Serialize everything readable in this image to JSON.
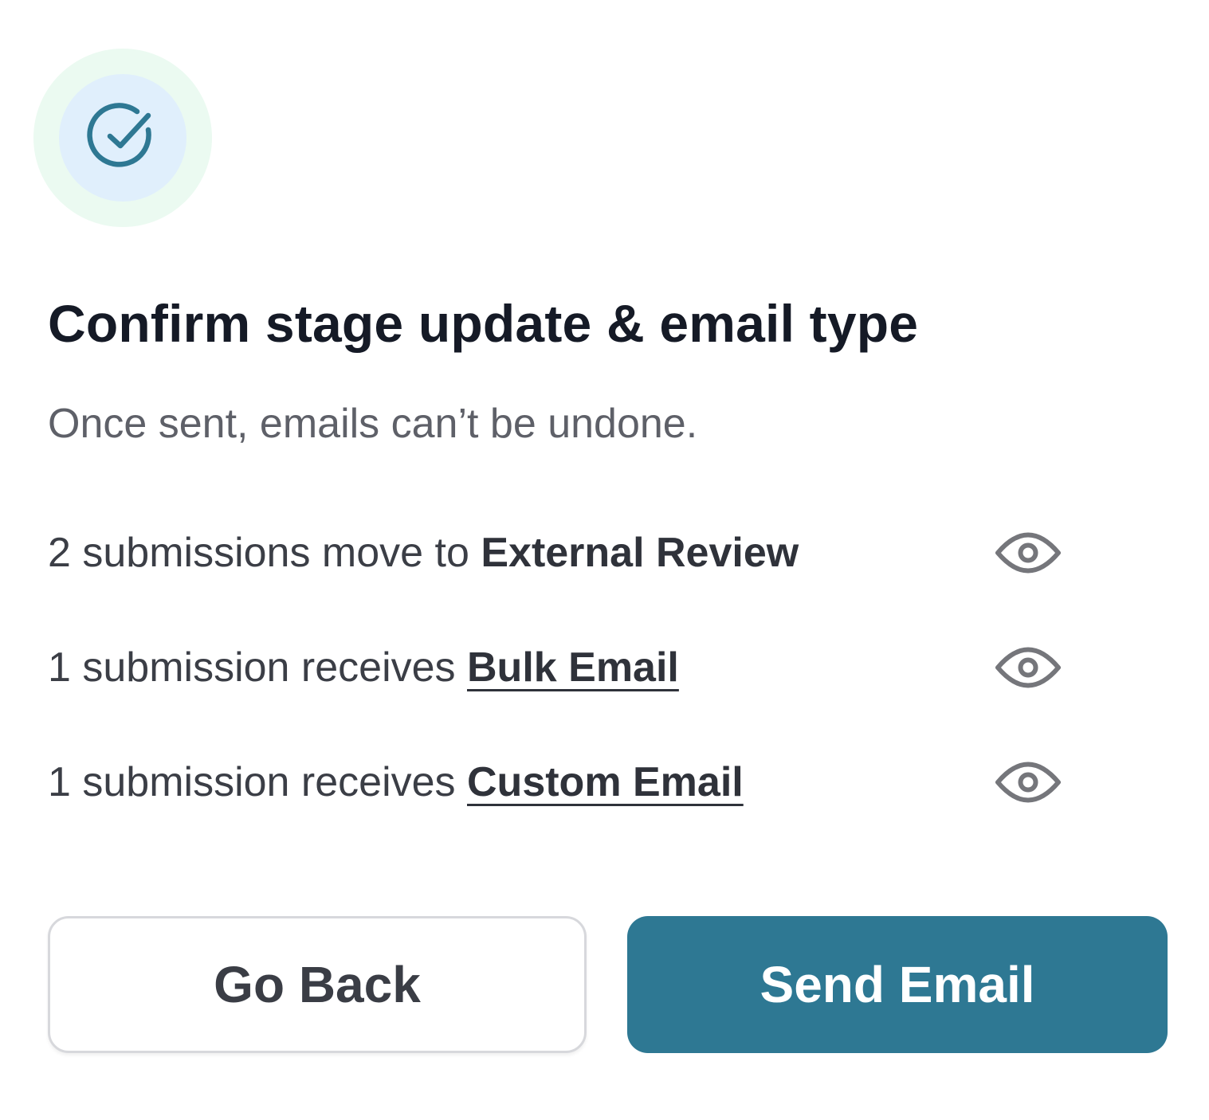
{
  "dialog": {
    "title": "Confirm stage update & email type",
    "subtitle": "Once sent, emails can’t be undone.",
    "icon": "check-circle-icon",
    "colors": {
      "accent": "#2e7893",
      "halo_outer": "#ebfaf1",
      "halo_inner": "#e0effc"
    }
  },
  "summary": {
    "rows": [
      {
        "prefix": "2 submissions move to ",
        "emphasis": "External Review",
        "linked": false,
        "action_icon": "eye-icon"
      },
      {
        "prefix": "1 submission receives ",
        "emphasis": "Bulk Email",
        "linked": true,
        "action_icon": "eye-icon"
      },
      {
        "prefix": "1 submission receives ",
        "emphasis": "Custom Email",
        "linked": true,
        "action_icon": "eye-icon"
      }
    ]
  },
  "actions": {
    "back_label": "Go Back",
    "send_label": "Send Email"
  }
}
